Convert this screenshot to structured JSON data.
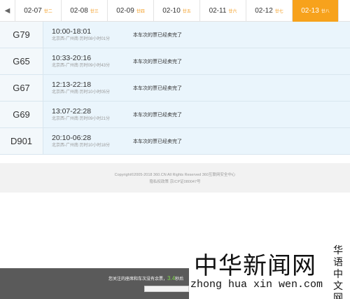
{
  "date_bar": {
    "prev_icon": "chevron-left-icon",
    "tabs": [
      {
        "date": "02-07",
        "weekday": "廿二"
      },
      {
        "date": "02-08",
        "weekday": "廿三"
      },
      {
        "date": "02-09",
        "weekday": "廿四"
      },
      {
        "date": "02-10",
        "weekday": "廿五"
      },
      {
        "date": "02-11",
        "weekday": "廿六"
      },
      {
        "date": "02-12",
        "weekday": "廿七"
      },
      {
        "date": "02-13",
        "weekday": "廿八"
      }
    ],
    "active_index": 6,
    "active_color": "#f7a21c"
  },
  "trains": [
    {
      "code": "G79",
      "time": "10:00-18:01",
      "route": "北京西-广州南 历时08小时01分",
      "status": "本车次的票已经卖完了"
    },
    {
      "code": "G65",
      "time": "10:33-20:16",
      "route": "北京西-广州南 历时09小时43分",
      "status": "本车次的票已经卖完了"
    },
    {
      "code": "G67",
      "time": "12:13-22:18",
      "route": "北京西-广州南 历时10小时05分",
      "status": "本车次的票已经卖完了"
    },
    {
      "code": "G69",
      "time": "13:07-22:28",
      "route": "北京西-广州南 历时09小时21分",
      "status": "本车次的票已经卖完了"
    },
    {
      "code": "D901",
      "time": "20:10-06:28",
      "route": "北京西-广州南 历时10小时18分",
      "status": "本车次的票已经卖完了"
    }
  ],
  "footer": {
    "copyright": "Copyright©2005-2018 360.CN All Rights Reserved 360互联网安全中心",
    "links": "隐私权政策 京ICP证080047号"
  },
  "notice": {
    "text_before": "您关注的座席和车次没有余票，",
    "countdown": "3.4",
    "text_after": "秒后"
  },
  "watermark": {
    "title": "中华新闻网",
    "url": "zhong hua xin wen.com",
    "vertical": "华语中文网"
  }
}
